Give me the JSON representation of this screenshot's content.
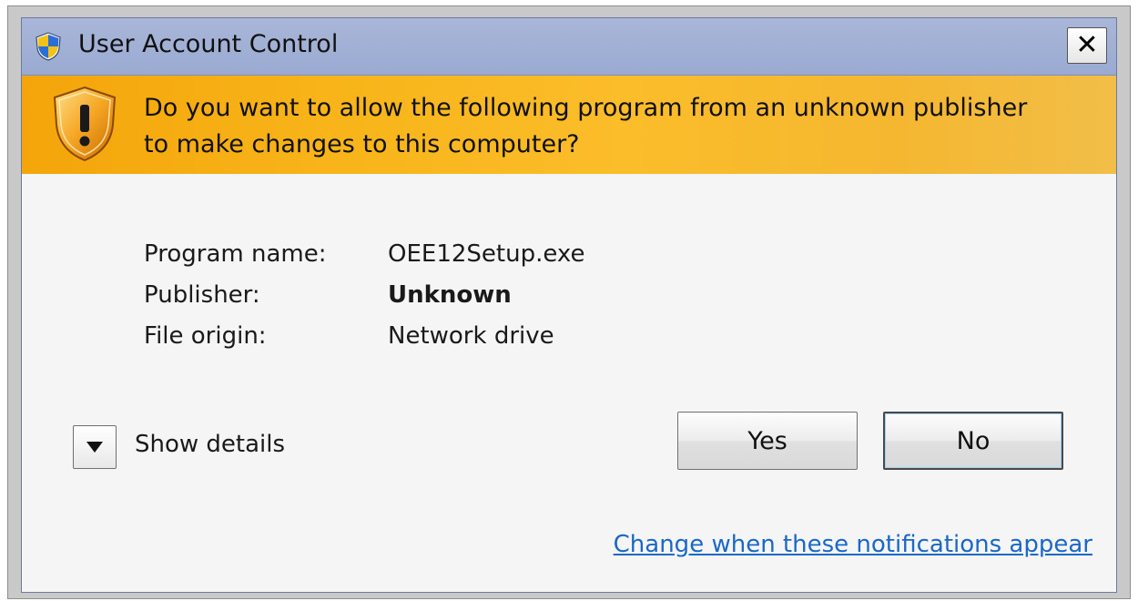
{
  "window": {
    "title": "User Account Control",
    "close_label": "✕"
  },
  "banner": {
    "question_line1": "Do you want to allow the following program from an unknown publisher",
    "question_line2": "to make changes to this computer?"
  },
  "info": {
    "rows": [
      {
        "label": "Program name:",
        "value": "OEE12Setup.exe"
      },
      {
        "label": "Publisher:",
        "value": "Unknown"
      },
      {
        "label": "File origin:",
        "value": "Network drive"
      }
    ]
  },
  "details": {
    "label": "Show details"
  },
  "buttons": {
    "yes": "Yes",
    "no": "No"
  },
  "link": {
    "label": "Change when these notifications appear"
  },
  "colors": {
    "banner": "#f8b51a",
    "titlebar": "#9aaad2",
    "link": "#1a68c8"
  }
}
